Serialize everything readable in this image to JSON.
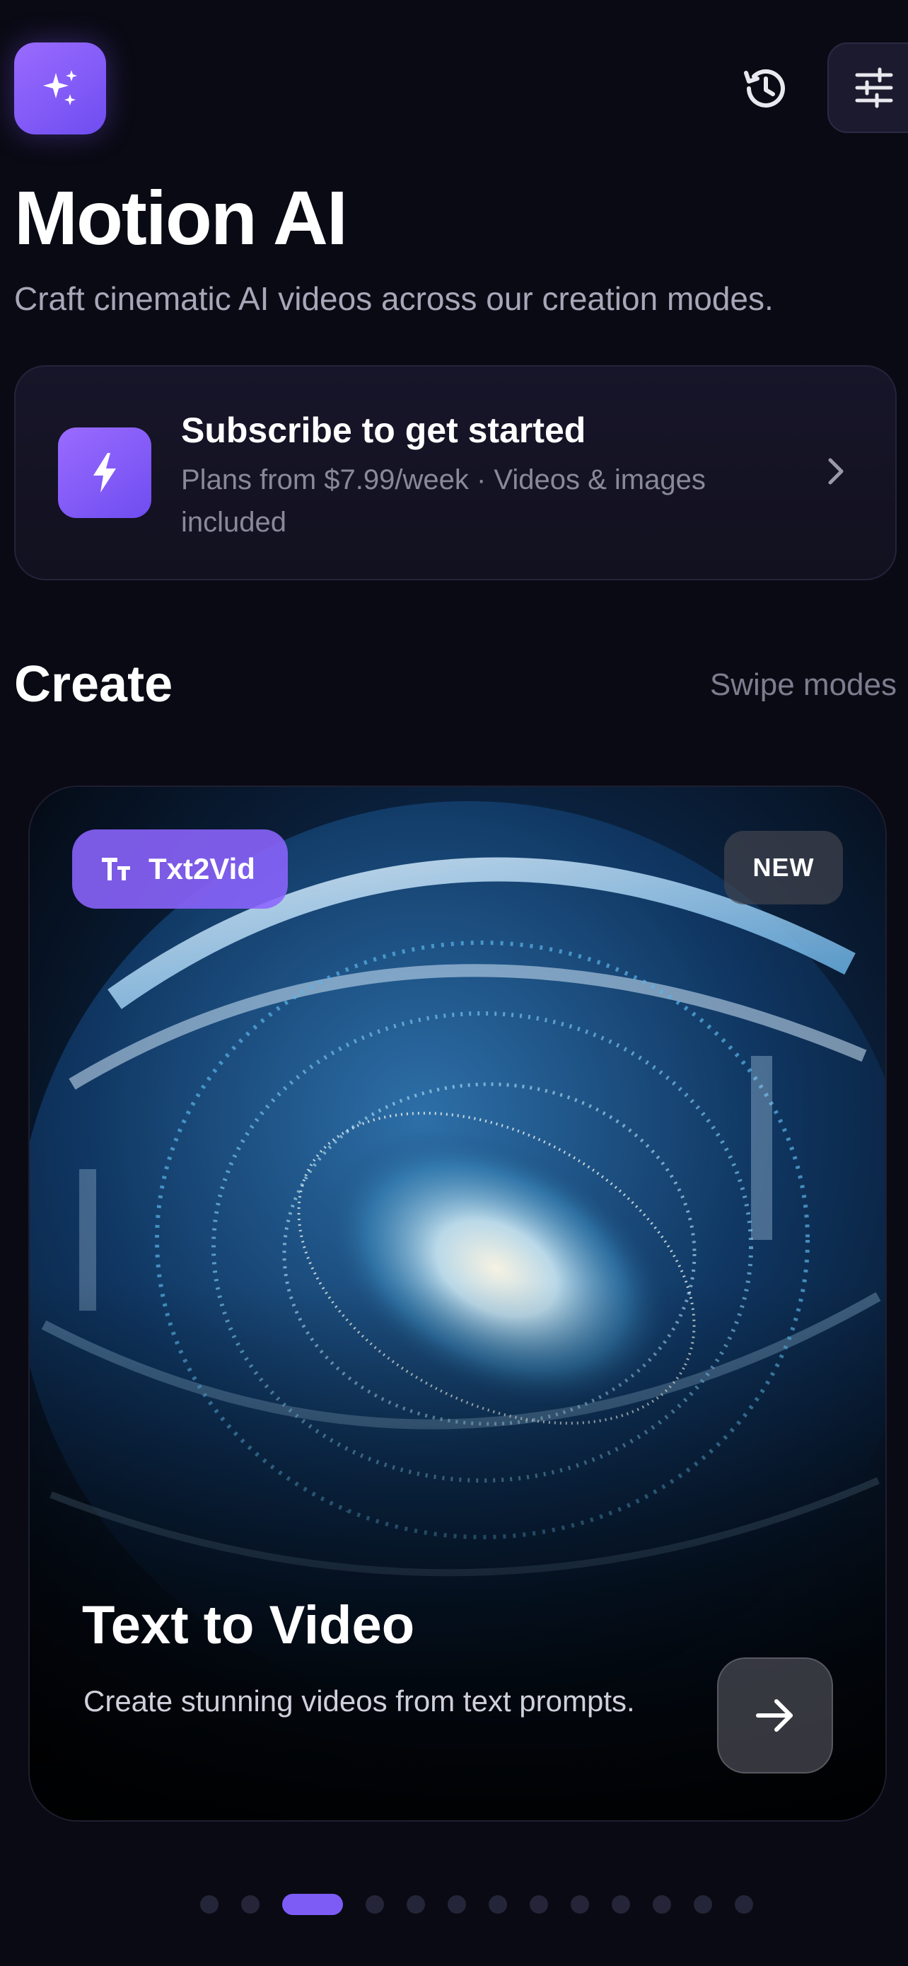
{
  "app": {
    "title": "Motion AI",
    "subtitle": "Craft cinematic AI videos across our creation modes.",
    "logo_icon": "sparkles-icon"
  },
  "header": {
    "history_icon": "history-icon",
    "settings_icon": "sliders-icon"
  },
  "subscribe": {
    "title": "Subscribe to get started",
    "description": "Plans from $7.99/week · Videos & images included",
    "icon": "lightning-bolt-icon",
    "chevron_icon": "chevron-right-icon"
  },
  "create_section": {
    "title": "Create",
    "hint": "Swipe modes"
  },
  "mode_card": {
    "chip_label": "Txt2Vid",
    "chip_icon": "text-size-icon",
    "badge": "NEW",
    "title": "Text to Video",
    "description": "Create stunning videos from text prompts.",
    "action_icon": "arrow-right-icon"
  },
  "pager": {
    "total": 13,
    "active_index": 2
  },
  "colors": {
    "background": "#0a0a14",
    "accent": "#8a63ff",
    "accent_dark": "#6f4df0",
    "card_surface": "#171529",
    "muted_text": "#8a8899"
  }
}
